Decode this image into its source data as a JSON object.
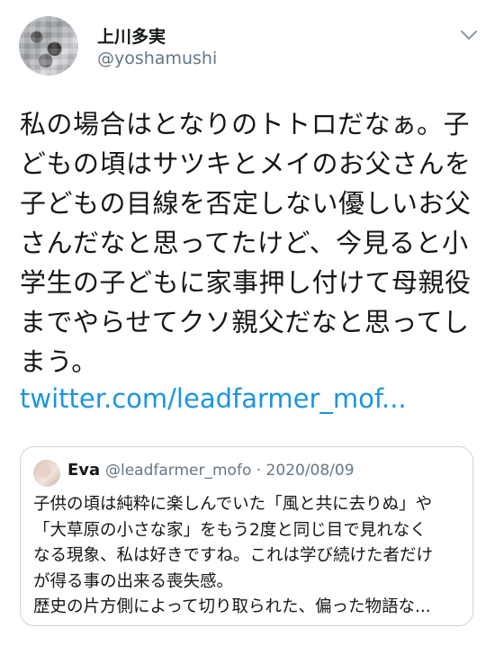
{
  "author": {
    "display_name": "上川多実",
    "handle": "@yoshamushi"
  },
  "tweet": {
    "lines": [
      "私の場合はとなりのトトロだなぁ。子",
      "どもの頃はサツキとメイのお父さんを",
      "子どもの目線を否定しない優しいお父",
      "さんだなと思ってたけど、今見ると小",
      "学生の子どもに家事押し付けて母親役",
      "までやらせてクソ親父だなと思ってし",
      "まう。"
    ],
    "link": "twitter.com/leadfarmer_mof..."
  },
  "quoted_tweet": {
    "display_name": "Eva",
    "handle_date": "@leadfarmer_mofo · 2020/08/09",
    "lines": [
      "子供の頃は純粋に楽しんでいた「風と共に去りぬ」や",
      "「大草原の小さな家」をもう2度と同じ目で見れなく",
      "なる現象、私は好きですね。これは学び続けた者だけ",
      "が得る事の出来る喪失感。",
      "歴史の片方側によって切り取られた、偏った物語な..."
    ]
  },
  "icons": {
    "menu": "chevron-down-icon"
  },
  "colors": {
    "link": "#1b95e0",
    "secondary_text": "#657786",
    "border": "#ccd6dd"
  }
}
